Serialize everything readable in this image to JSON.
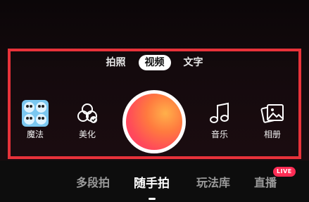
{
  "mode_tabs": [
    {
      "label": "拍照"
    },
    {
      "label": "视频",
      "active": true
    },
    {
      "label": "文字"
    }
  ],
  "tools": {
    "magic": "魔法",
    "beautify": "美化",
    "music": "音乐",
    "album": "相册"
  },
  "bottom_tabs": [
    {
      "label": "多段拍"
    },
    {
      "label": "随手拍",
      "active": true
    },
    {
      "label": "玩法库"
    },
    {
      "label": "直播"
    }
  ],
  "live_badge": "LIVE",
  "colors": {
    "highlight": "#e8323a",
    "shutter_gradient_start": "#ffb04a",
    "shutter_gradient_end": "#fe3a6a",
    "live_badge": "#ff2d55"
  },
  "icons": {
    "magic": "panda-grid-icon",
    "beautify": "beauty-filter-icon",
    "music": "music-note-icon",
    "album": "album-photo-icon"
  }
}
